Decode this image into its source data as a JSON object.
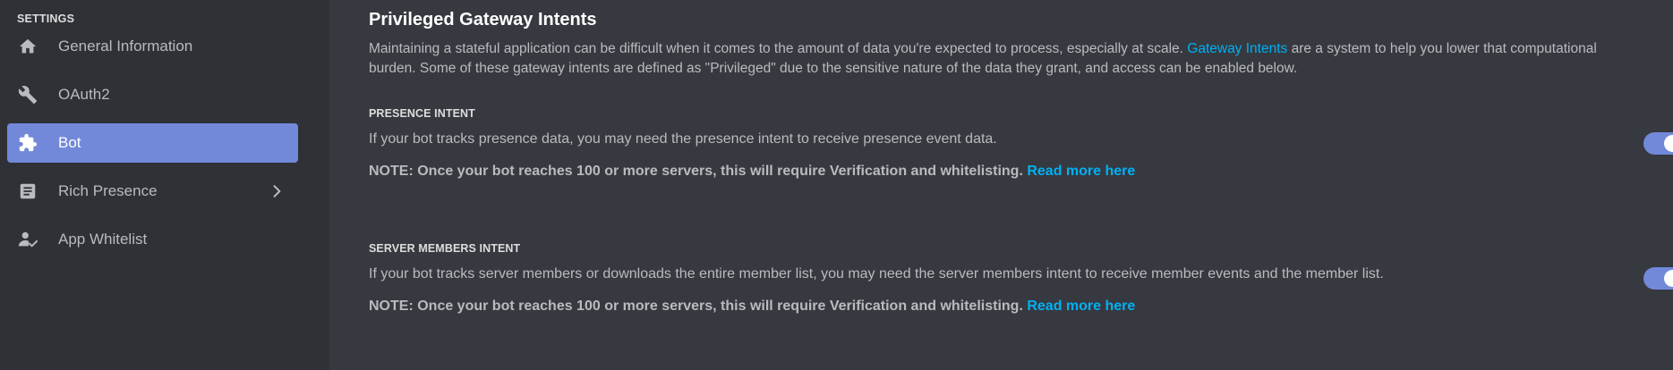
{
  "sidebar": {
    "heading": "SETTINGS",
    "items": [
      {
        "label": "General Information",
        "icon": "home-icon"
      },
      {
        "label": "OAuth2",
        "icon": "wrench-icon"
      },
      {
        "label": "Bot",
        "icon": "puzzle-icon",
        "active": true
      },
      {
        "label": "Rich Presence",
        "icon": "document-icon",
        "has_chevron": true
      },
      {
        "label": "App Whitelist",
        "icon": "user-list-icon"
      }
    ]
  },
  "main": {
    "title": "Privileged Gateway Intents",
    "intro_before_link": "Maintaining a stateful application can be difficult when it comes to the amount of data you're expected to process, especially at scale. ",
    "intro_link": "Gateway Intents",
    "intro_after_link": " are a system to help you lower that computational burden. Some of these gateway intents are defined as \"Privileged\" due to the sensitive nature of the data they grant, and access can be enabled below.",
    "sections": [
      {
        "label": "PRESENCE INTENT",
        "description": "If your bot tracks presence data, you may need the presence intent to receive presence event data.",
        "note": "NOTE: Once your bot reaches 100 or more servers, this will require Verification and whitelisting.",
        "note_link": "Read more here",
        "enabled": true
      },
      {
        "label": "SERVER MEMBERS INTENT",
        "description": "If your bot tracks server members or downloads the entire member list, you may need the server members intent to receive member events and the member list.",
        "note": "NOTE: Once your bot reaches 100 or more servers, this will require Verification and whitelisting.",
        "note_link": "Read more here",
        "enabled": true
      }
    ]
  },
  "colors": {
    "accent": "#7289da",
    "link": "#00b0f4",
    "sidebar_bg": "#2f3136",
    "main_bg": "#36393f"
  }
}
